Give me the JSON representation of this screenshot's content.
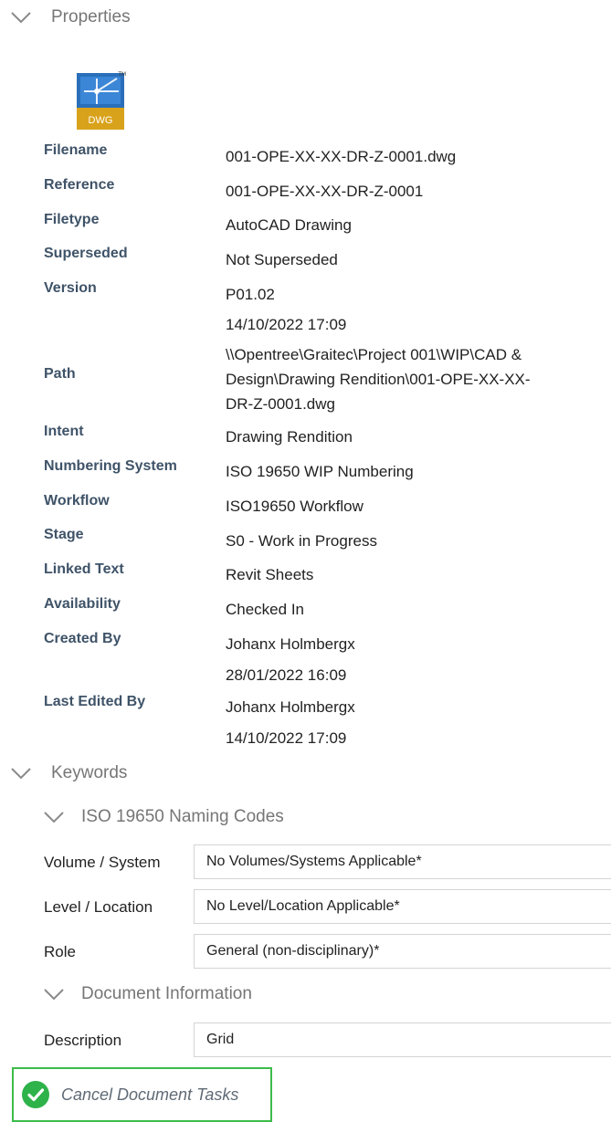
{
  "properties": {
    "title": "Properties",
    "file_icon_label": "DWG",
    "file_icon_mark": "TM",
    "rows": {
      "filename": {
        "label": "Filename",
        "value": "001-OPE-XX-XX-DR-Z-0001.dwg"
      },
      "reference": {
        "label": "Reference",
        "value": "001-OPE-XX-XX-DR-Z-0001"
      },
      "filetype": {
        "label": "Filetype",
        "value": "AutoCAD Drawing"
      },
      "superseded": {
        "label": "Superseded",
        "value": "Not Superseded"
      },
      "version": {
        "label": "Version",
        "value": "P01.02",
        "date": "14/10/2022 17:09"
      },
      "path": {
        "label": "Path",
        "line1": "\\\\Opentree\\Graitec\\Project 001\\WIP\\CAD &",
        "line2": "Design\\Drawing Rendition\\001-OPE-XX-XX-",
        "line3": "DR-Z-0001.dwg"
      },
      "intent": {
        "label": "Intent",
        "value": "Drawing Rendition"
      },
      "numbering": {
        "label": "Numbering System",
        "value": "ISO 19650 WIP Numbering"
      },
      "workflow": {
        "label": "Workflow",
        "value": "ISO19650 Workflow"
      },
      "stage": {
        "label": "Stage",
        "value": "S0 - Work in Progress"
      },
      "linked": {
        "label": "Linked Text",
        "value": "Revit Sheets"
      },
      "availability": {
        "label": "Availability",
        "value": "Checked In"
      },
      "created": {
        "label": "Created By",
        "value": "Johanx Holmbergx",
        "date": "28/01/2022 16:09"
      },
      "edited": {
        "label": "Last Edited By",
        "value": "Johanx Holmbergx",
        "date": "14/10/2022 17:09"
      }
    }
  },
  "keywords": {
    "title": "Keywords",
    "naming": {
      "title": "ISO 19650 Naming Codes",
      "volume": {
        "label": "Volume / System",
        "value": "No Volumes/Systems Applicable*"
      },
      "level": {
        "label": "Level / Location",
        "value": "No Level/Location Applicable*"
      },
      "role": {
        "label": "Role",
        "value": "General (non-disciplinary)*"
      }
    },
    "doc_info": {
      "title": "Document Information",
      "description": {
        "label": "Description",
        "value": "Grid"
      }
    }
  },
  "actions": {
    "cancel_tasks": "Cancel Document Tasks"
  },
  "colors": {
    "label_text": "#3f5368",
    "header_text": "#767676",
    "button_border": "#3cbc4a",
    "check_fill": "#2eb24a",
    "dwg_blue": "#2a6fba",
    "dwg_gold": "#d9a21b"
  }
}
